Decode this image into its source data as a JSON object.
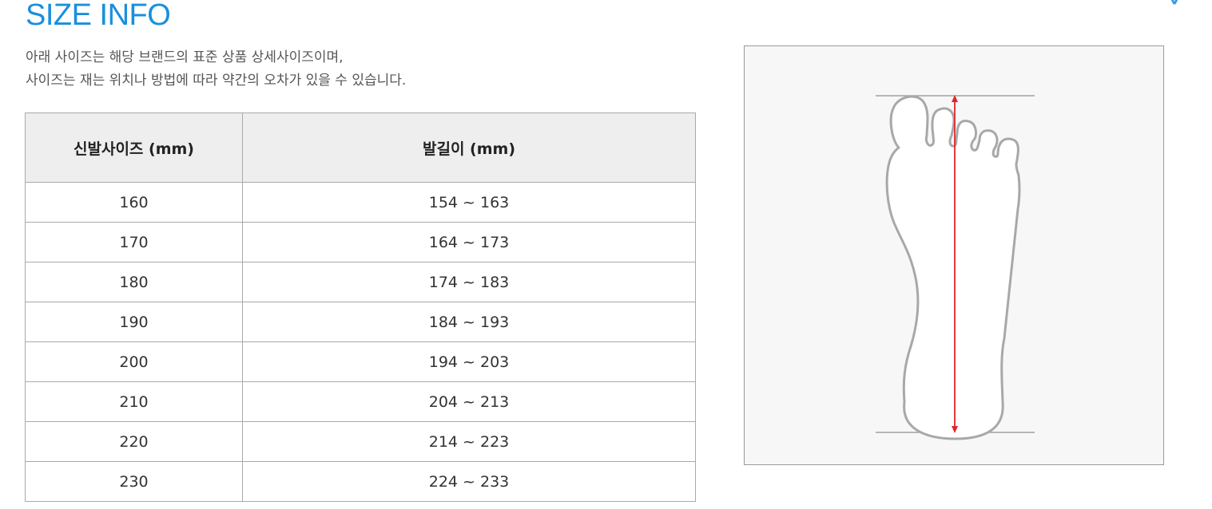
{
  "header": {
    "title": "SIZE INFO",
    "description_line1": "아래 사이즈는 해당 브랜드의 표준 상품 상세사이즈이며,",
    "description_line2": "사이즈는 재는 위치나 방법에 따라 약간의 오차가 있을 수 있습니다.",
    "close_icon": "close-icon",
    "accent_color": "#1a8fdd"
  },
  "size_table": {
    "columns": [
      "신발사이즈 (mm)",
      "발길이 (mm)"
    ],
    "rows": [
      {
        "shoe_size": "160",
        "foot_length": "154 ~ 163"
      },
      {
        "shoe_size": "170",
        "foot_length": "164 ~ 173"
      },
      {
        "shoe_size": "180",
        "foot_length": "174 ~ 183"
      },
      {
        "shoe_size": "190",
        "foot_length": "184 ~ 193"
      },
      {
        "shoe_size": "200",
        "foot_length": "194 ~ 203"
      },
      {
        "shoe_size": "210",
        "foot_length": "204 ~ 213"
      },
      {
        "shoe_size": "220",
        "foot_length": "214 ~ 223"
      },
      {
        "shoe_size": "230",
        "foot_length": "224 ~ 233"
      }
    ]
  },
  "figure": {
    "icon": "foot-length-diagram",
    "measure_color": "#e0262b"
  }
}
